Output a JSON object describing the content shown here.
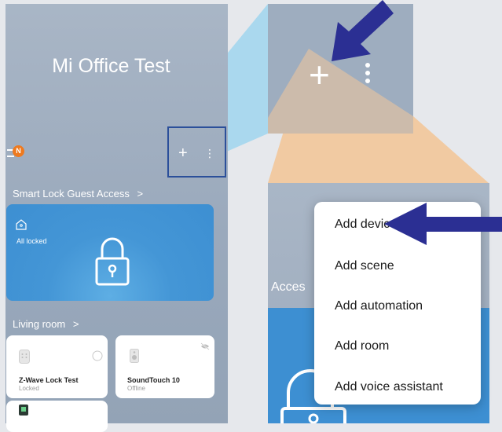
{
  "home": {
    "title": "Mi Office Test",
    "notification_badge": "N"
  },
  "smart_lock": {
    "section_title": "Smart Lock Guest Access",
    "chevron": ">",
    "status": "All locked"
  },
  "room": {
    "title": "Living room",
    "chevron": ">"
  },
  "devices": [
    {
      "name": "Z-Wave Lock Test",
      "status": "Locked"
    },
    {
      "name": "SoundTouch 10",
      "status": "Offline"
    }
  ],
  "zoom": {
    "partial_label": "Acces"
  },
  "add_menu": {
    "items": [
      "Add device",
      "Add scene",
      "Add automation",
      "Add room",
      "Add voice assistant"
    ]
  },
  "colors": {
    "accent_arrow": "#2b2f93",
    "badge": "#ee7a1f",
    "lock_card": "#3d8fd2",
    "zoom_cone_blue": "#9fd5ef",
    "zoom_cone_orange": "#f2c79a"
  },
  "icons": [
    "bell-icon",
    "plus-icon",
    "more-vertical-icon",
    "home-icon",
    "padlock-icon",
    "power-icon",
    "speaker-icon",
    "mute-icon",
    "arrow-icon"
  ]
}
